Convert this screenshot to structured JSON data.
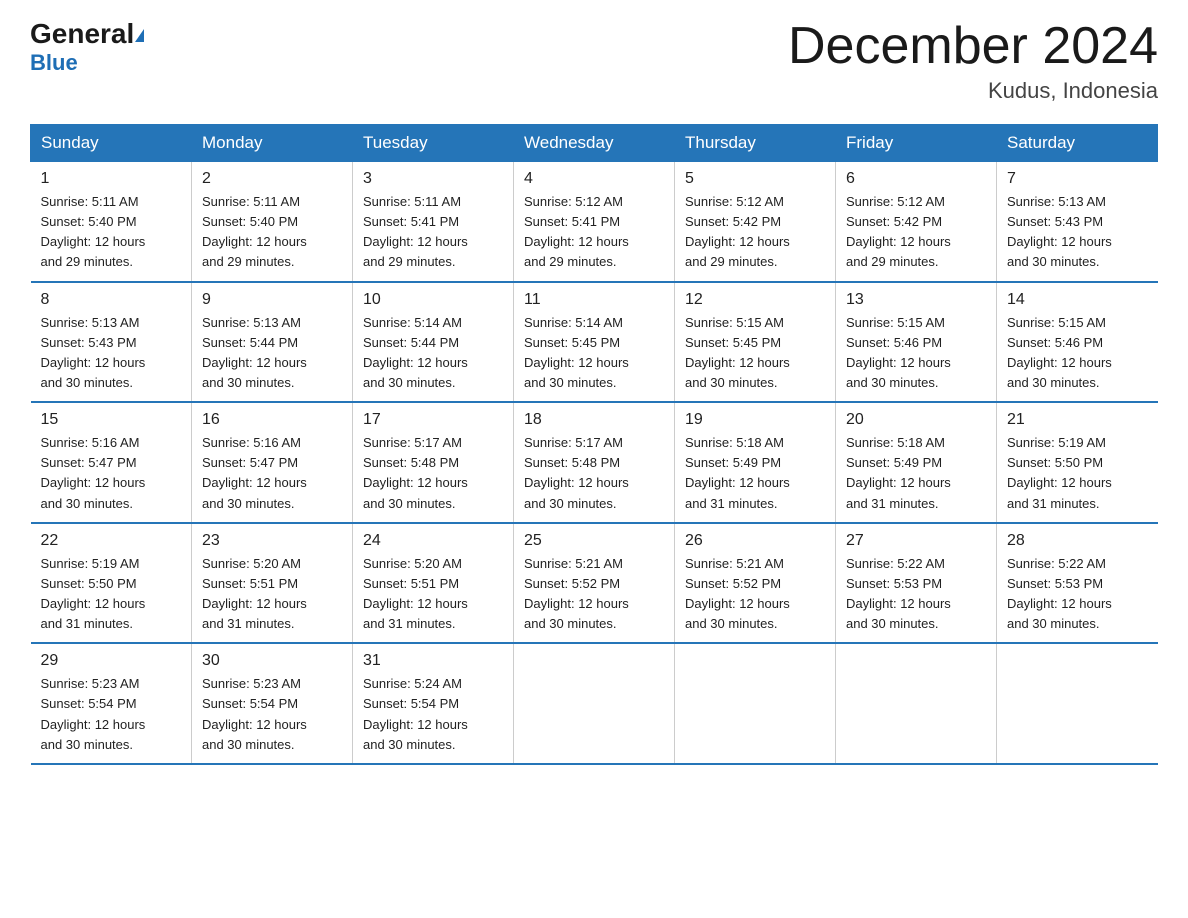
{
  "header": {
    "logo_general": "General",
    "logo_blue": "Blue",
    "month_title": "December 2024",
    "location": "Kudus, Indonesia"
  },
  "columns": [
    "Sunday",
    "Monday",
    "Tuesday",
    "Wednesday",
    "Thursday",
    "Friday",
    "Saturday"
  ],
  "weeks": [
    [
      {
        "day": "1",
        "sunrise": "5:11 AM",
        "sunset": "5:40 PM",
        "daylight": "12 hours and 29 minutes."
      },
      {
        "day": "2",
        "sunrise": "5:11 AM",
        "sunset": "5:40 PM",
        "daylight": "12 hours and 29 minutes."
      },
      {
        "day": "3",
        "sunrise": "5:11 AM",
        "sunset": "5:41 PM",
        "daylight": "12 hours and 29 minutes."
      },
      {
        "day": "4",
        "sunrise": "5:12 AM",
        "sunset": "5:41 PM",
        "daylight": "12 hours and 29 minutes."
      },
      {
        "day": "5",
        "sunrise": "5:12 AM",
        "sunset": "5:42 PM",
        "daylight": "12 hours and 29 minutes."
      },
      {
        "day": "6",
        "sunrise": "5:12 AM",
        "sunset": "5:42 PM",
        "daylight": "12 hours and 29 minutes."
      },
      {
        "day": "7",
        "sunrise": "5:13 AM",
        "sunset": "5:43 PM",
        "daylight": "12 hours and 30 minutes."
      }
    ],
    [
      {
        "day": "8",
        "sunrise": "5:13 AM",
        "sunset": "5:43 PM",
        "daylight": "12 hours and 30 minutes."
      },
      {
        "day": "9",
        "sunrise": "5:13 AM",
        "sunset": "5:44 PM",
        "daylight": "12 hours and 30 minutes."
      },
      {
        "day": "10",
        "sunrise": "5:14 AM",
        "sunset": "5:44 PM",
        "daylight": "12 hours and 30 minutes."
      },
      {
        "day": "11",
        "sunrise": "5:14 AM",
        "sunset": "5:45 PM",
        "daylight": "12 hours and 30 minutes."
      },
      {
        "day": "12",
        "sunrise": "5:15 AM",
        "sunset": "5:45 PM",
        "daylight": "12 hours and 30 minutes."
      },
      {
        "day": "13",
        "sunrise": "5:15 AM",
        "sunset": "5:46 PM",
        "daylight": "12 hours and 30 minutes."
      },
      {
        "day": "14",
        "sunrise": "5:15 AM",
        "sunset": "5:46 PM",
        "daylight": "12 hours and 30 minutes."
      }
    ],
    [
      {
        "day": "15",
        "sunrise": "5:16 AM",
        "sunset": "5:47 PM",
        "daylight": "12 hours and 30 minutes."
      },
      {
        "day": "16",
        "sunrise": "5:16 AM",
        "sunset": "5:47 PM",
        "daylight": "12 hours and 30 minutes."
      },
      {
        "day": "17",
        "sunrise": "5:17 AM",
        "sunset": "5:48 PM",
        "daylight": "12 hours and 30 minutes."
      },
      {
        "day": "18",
        "sunrise": "5:17 AM",
        "sunset": "5:48 PM",
        "daylight": "12 hours and 30 minutes."
      },
      {
        "day": "19",
        "sunrise": "5:18 AM",
        "sunset": "5:49 PM",
        "daylight": "12 hours and 31 minutes."
      },
      {
        "day": "20",
        "sunrise": "5:18 AM",
        "sunset": "5:49 PM",
        "daylight": "12 hours and 31 minutes."
      },
      {
        "day": "21",
        "sunrise": "5:19 AM",
        "sunset": "5:50 PM",
        "daylight": "12 hours and 31 minutes."
      }
    ],
    [
      {
        "day": "22",
        "sunrise": "5:19 AM",
        "sunset": "5:50 PM",
        "daylight": "12 hours and 31 minutes."
      },
      {
        "day": "23",
        "sunrise": "5:20 AM",
        "sunset": "5:51 PM",
        "daylight": "12 hours and 31 minutes."
      },
      {
        "day": "24",
        "sunrise": "5:20 AM",
        "sunset": "5:51 PM",
        "daylight": "12 hours and 31 minutes."
      },
      {
        "day": "25",
        "sunrise": "5:21 AM",
        "sunset": "5:52 PM",
        "daylight": "12 hours and 30 minutes."
      },
      {
        "day": "26",
        "sunrise": "5:21 AM",
        "sunset": "5:52 PM",
        "daylight": "12 hours and 30 minutes."
      },
      {
        "day": "27",
        "sunrise": "5:22 AM",
        "sunset": "5:53 PM",
        "daylight": "12 hours and 30 minutes."
      },
      {
        "day": "28",
        "sunrise": "5:22 AM",
        "sunset": "5:53 PM",
        "daylight": "12 hours and 30 minutes."
      }
    ],
    [
      {
        "day": "29",
        "sunrise": "5:23 AM",
        "sunset": "5:54 PM",
        "daylight": "12 hours and 30 minutes."
      },
      {
        "day": "30",
        "sunrise": "5:23 AM",
        "sunset": "5:54 PM",
        "daylight": "12 hours and 30 minutes."
      },
      {
        "day": "31",
        "sunrise": "5:24 AM",
        "sunset": "5:54 PM",
        "daylight": "12 hours and 30 minutes."
      },
      null,
      null,
      null,
      null
    ]
  ],
  "labels": {
    "sunrise": "Sunrise:",
    "sunset": "Sunset:",
    "daylight": "Daylight: 12 hours"
  }
}
